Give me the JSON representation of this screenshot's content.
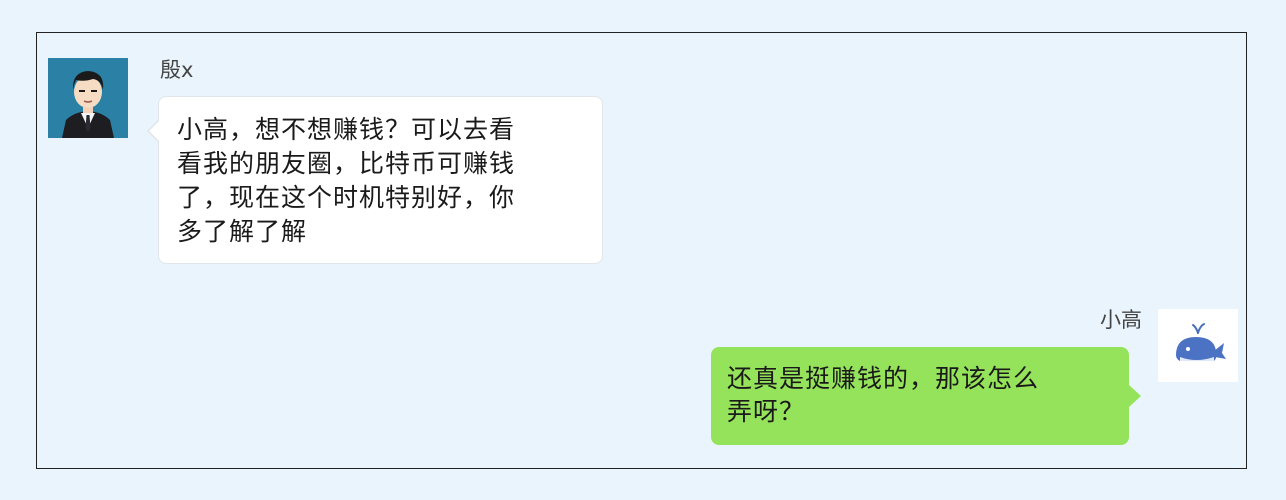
{
  "conversation": {
    "incoming": {
      "sender_name": "殷x",
      "avatar_icon": "businessman-cartoon-avatar-icon",
      "message_lines": [
        "小高，想不想赚钱？可以去看",
        "看我的朋友圈，比特币可赚钱",
        "了，现在这个时机特别好，你",
        "多了解了解"
      ]
    },
    "outgoing": {
      "sender_name": "小高",
      "avatar_icon": "whale-avatar-icon",
      "message_lines": [
        "还真是挺赚钱的，那该怎么",
        "弄呀？"
      ]
    }
  },
  "colors": {
    "page_background": "#eaf4fc",
    "incoming_bubble": "#ffffff",
    "outgoing_bubble": "#95e35a",
    "avatar_left_background": "#2b80a6"
  }
}
